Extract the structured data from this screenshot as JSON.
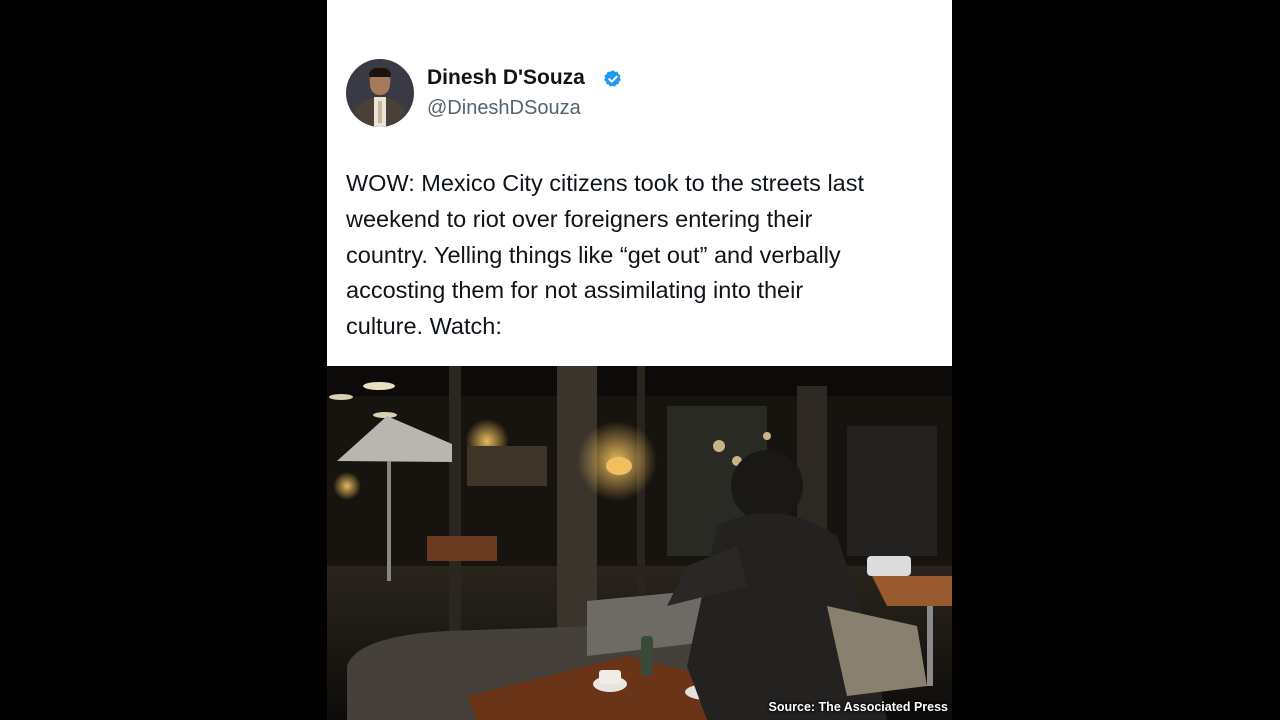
{
  "tweet": {
    "author_name": "Dinesh D'Souza",
    "author_handle": "@DineshDSouza",
    "verified_icon": "verified-badge-icon",
    "text_lines": [
      "WOW: Mexico City citizens took to the streets last",
      "weekend to riot over foreigners entering their",
      "country. Yelling things like “get out” and verbally",
      "accosting them for not assimilating into their",
      "culture. Watch:"
    ]
  },
  "video": {
    "source_caption": "Source: The Associated Press"
  },
  "colors": {
    "verified_blue": "#1d9bf0",
    "name_text": "#0f1419",
    "handle_text": "#536471",
    "side_bars": "#000000"
  }
}
